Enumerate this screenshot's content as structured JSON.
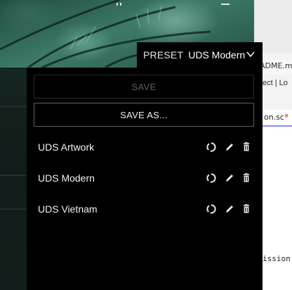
{
  "editor": {
    "tab_text": "ADME.m",
    "row2_text": "ect  | Lo",
    "tab2_text": "on.sc",
    "tab2_close": "×",
    "body_text": "ission"
  },
  "preset": {
    "label": "PRESET",
    "current": "UDS Modern"
  },
  "panel": {
    "save_label": "SAVE",
    "save_as_label": "SAVE AS...",
    "items": [
      {
        "name": "UDS Artwork"
      },
      {
        "name": "UDS Modern"
      },
      {
        "name": "UDS Vietnam"
      }
    ]
  },
  "colors": {
    "panel_bg": "#000000",
    "text": "#f2f2f2",
    "disabled_text": "#5c5c5c",
    "border": "#5e5e5e"
  },
  "icons": {
    "refresh": "refresh-icon",
    "edit": "pencil-icon",
    "delete": "trash-icon",
    "chevron": "chevron-down-icon"
  }
}
